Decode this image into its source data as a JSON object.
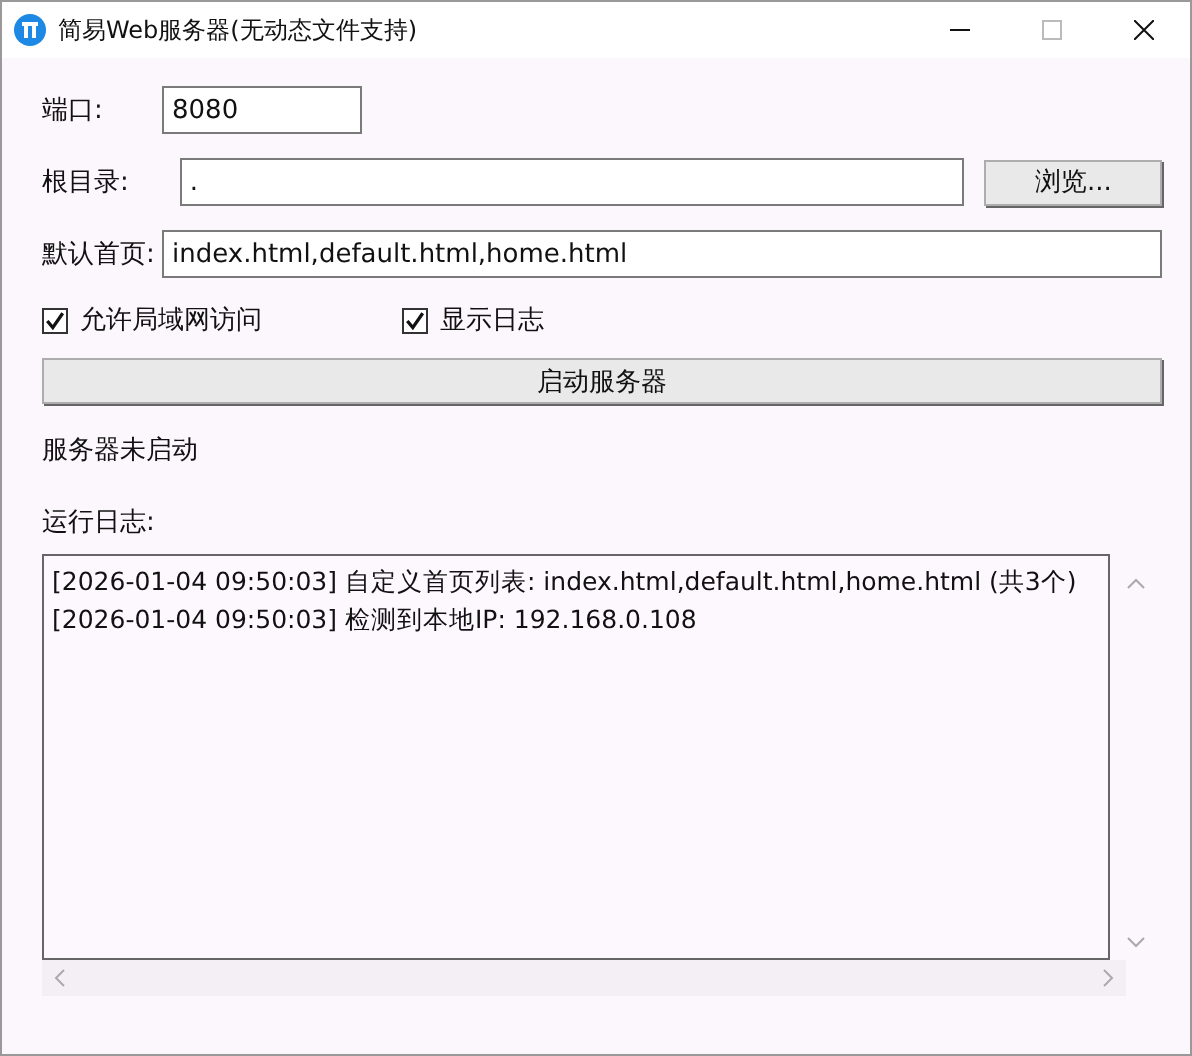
{
  "window": {
    "title": "简易Web服务器(无动态文件支持)"
  },
  "fields": [
    {
      "label": "端口:",
      "value": "8080",
      "kind": "short"
    },
    {
      "label": "根目录:",
      "value": ".",
      "kind": "browse",
      "button": "浏览..."
    },
    {
      "label": "默认首页:",
      "value": "index.html,default.html,home.html",
      "kind": "wide"
    }
  ],
  "options": [
    {
      "label": "允许局域网访问",
      "checked": true
    },
    {
      "label": "显示日志",
      "checked": true
    }
  ],
  "start_button": "启动服务器",
  "status": "服务器未启动",
  "log": {
    "label": "运行日志:",
    "lines": [
      "[2026-01-04 09:50:03] 自定义首页列表: index.html,default.html,home.html (共3个)",
      "[2026-01-04 09:50:03] 检测到本地IP: 192.168.0.108"
    ]
  }
}
